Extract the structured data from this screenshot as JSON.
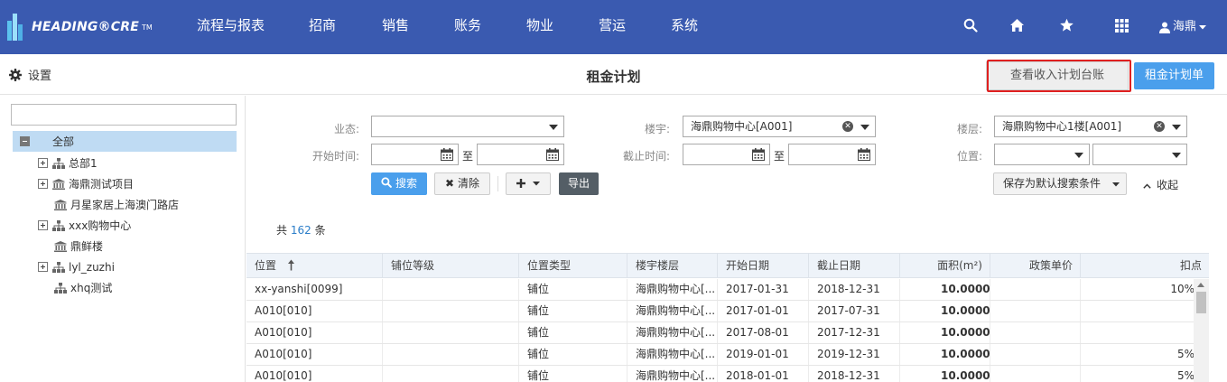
{
  "brand": {
    "name": "HEADING®CRE",
    "tm": "TM"
  },
  "nav": [
    "流程与报表",
    "招商",
    "销售",
    "账务",
    "物业",
    "营运",
    "系统"
  ],
  "user": {
    "name": "海鼎"
  },
  "header": {
    "settings_label": "设置",
    "title": "租金计划",
    "ledger_button": "查看收入计划台账",
    "plan_button": "租金计划单"
  },
  "tree": {
    "search_value": "",
    "items": [
      {
        "label": "全部"
      },
      {
        "label": "总部1"
      },
      {
        "label": "海鼎测试项目"
      },
      {
        "label": "月星家居上海澳门路店"
      },
      {
        "label": "xxx购物中心"
      },
      {
        "label": "鼎鲜楼"
      },
      {
        "label": "lyl_zuzhi"
      },
      {
        "label": "xhq测试"
      }
    ]
  },
  "filters": {
    "business_label": "业态:",
    "business_value": "",
    "building_label": "楼宇:",
    "building_value": "海鼎购物中心[A001]",
    "floor_label": "楼层:",
    "floor_value": "海鼎购物中心1楼[A001]",
    "start_label": "开始时间:",
    "end_label": "截止时间:",
    "to_label": "至",
    "position_label": "位置:",
    "search_button": "搜索",
    "clear_button": "清除",
    "export_button": "导出",
    "save_default_button": "保存为默认搜索条件",
    "collapse_label": "收起"
  },
  "summary": {
    "prefix": "共",
    "count": "162",
    "suffix": "条"
  },
  "table": {
    "columns": [
      "位置",
      "铺位等级",
      "位置类型",
      "楼宇楼层",
      "开始日期",
      "截止日期",
      "面积(m²)",
      "政策单价",
      "扣点"
    ],
    "rows": [
      {
        "pos": "xx-yanshi[0099]",
        "grade": "",
        "type": "铺位",
        "floor": "海鼎购物中心[...",
        "start": "2017-01-31",
        "end": "2018-12-31",
        "area": "10.0000",
        "price": "",
        "deduct": "10%"
      },
      {
        "pos": "A010[010]",
        "grade": "",
        "type": "铺位",
        "floor": "海鼎购物中心[...",
        "start": "2017-01-01",
        "end": "2017-07-31",
        "area": "10.0000",
        "price": "",
        "deduct": ""
      },
      {
        "pos": "A010[010]",
        "grade": "",
        "type": "铺位",
        "floor": "海鼎购物中心[...",
        "start": "2017-08-01",
        "end": "2017-12-31",
        "area": "10.0000",
        "price": "",
        "deduct": ""
      },
      {
        "pos": "A010[010]",
        "grade": "",
        "type": "铺位",
        "floor": "海鼎购物中心[...",
        "start": "2019-01-01",
        "end": "2019-12-31",
        "area": "10.0000",
        "price": "",
        "deduct": "5%"
      },
      {
        "pos": "A010[010]",
        "grade": "",
        "type": "铺位",
        "floor": "海鼎购物中心[...",
        "start": "2018-01-01",
        "end": "2018-12-31",
        "area": "10.0000",
        "price": "",
        "deduct": "5%"
      }
    ]
  }
}
